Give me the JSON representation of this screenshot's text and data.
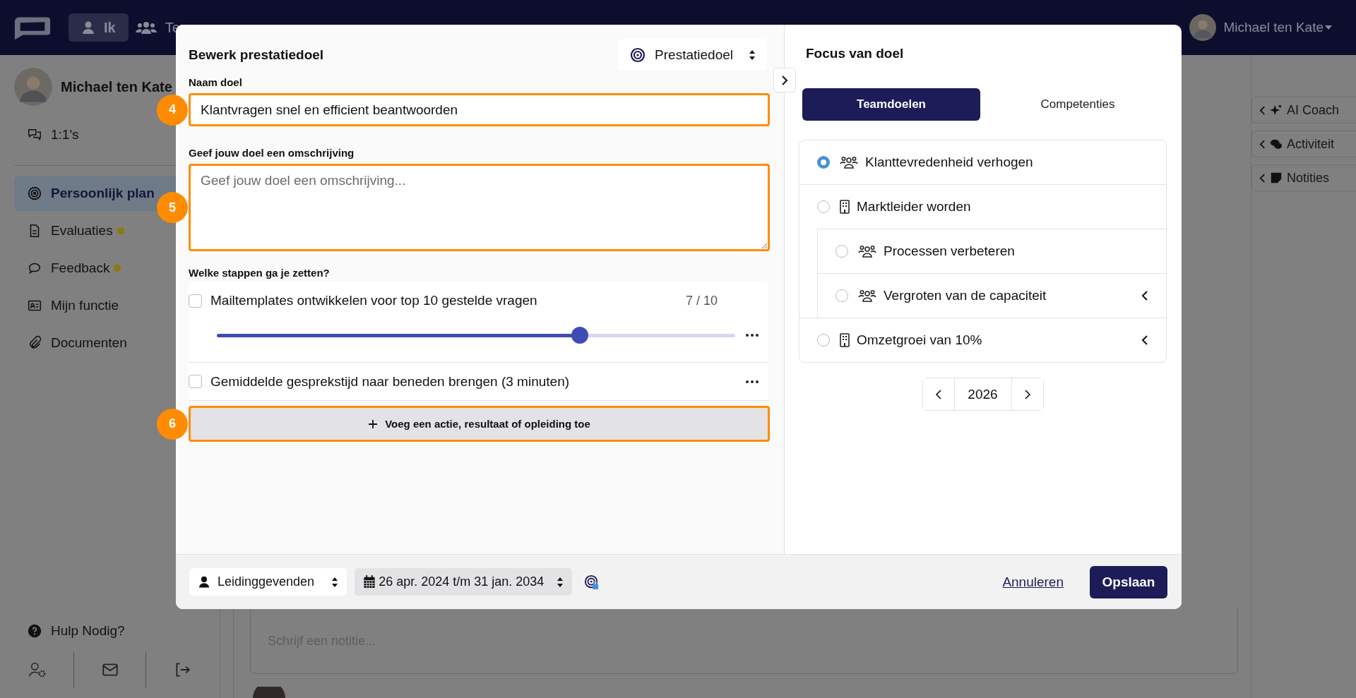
{
  "nav": {
    "tabs": [
      {
        "label": "Ik",
        "selected": true
      },
      {
        "label": "Te",
        "selected": false
      }
    ],
    "user": "Michael ten Kate"
  },
  "sidebar": {
    "profile_name": "Michael ten Kate",
    "top_item": "1:1's",
    "items": [
      {
        "label": "Persoonlijk plan",
        "selected": true,
        "dot": false
      },
      {
        "label": "Evaluaties",
        "selected": false,
        "dot": true
      },
      {
        "label": "Feedback",
        "selected": false,
        "dot": true
      },
      {
        "label": "Mijn functie",
        "selected": false,
        "dot": false
      },
      {
        "label": "Documenten",
        "selected": false,
        "dot": false
      }
    ],
    "help": "Hulp Nodig?"
  },
  "side_panels": [
    "AI Coach",
    "Activiteit",
    "Notities"
  ],
  "note": {
    "placeholder": "Schrijf een notitie..."
  },
  "modal": {
    "title": "Bewerk prestatiedoel",
    "type_select": "Prestatiedoel",
    "name_label": "Naam doel",
    "name_value": "Klantvragen snel en efficient beantwoorden",
    "name_marker": "4",
    "desc_label": "Geef jouw doel een omschrijving",
    "desc_placeholder": "Geef jouw doel een omschrijving...",
    "desc_marker": "5",
    "steps_label": "Welke stappen ga je zetten?",
    "steps": [
      {
        "kind": "slider",
        "label": "Mailtemplates ontwikkelen voor top 10 gestelde vragen",
        "checked": false,
        "reading": "7 / 10",
        "level": 0.7
      },
      {
        "kind": "plain",
        "label": "Gemiddelde gesprekstijd naar beneden brengen (3 minuten)",
        "checked": false
      }
    ],
    "add_button": "Voeg een actie, resultaat of opleiding toe",
    "add_marker": "6",
    "audience": "Leidinggevenden",
    "period": "26 apr. 2024 t/m 31 jan. 2034",
    "cancel": "Annuleren",
    "save": "Opslaan"
  },
  "focus": {
    "title": "Focus van doel",
    "tabs": [
      {
        "label": "Teamdoelen",
        "selected": true
      },
      {
        "label": "Competenties",
        "selected": false
      }
    ],
    "goals": [
      {
        "kind": "team",
        "label": "Klanttevredenheid verhogen",
        "selected": true
      },
      {
        "kind": "company",
        "label": "Marktleider worden",
        "selected": false,
        "expanded": true,
        "children": [
          {
            "kind": "team",
            "label": "Processen verbeteren",
            "selected": false
          },
          {
            "kind": "team",
            "label": "Vergroten van de capaciteit",
            "selected": false,
            "expanded": false
          }
        ]
      },
      {
        "kind": "company",
        "label": "Omzetgroei van 10%",
        "selected": false,
        "expanded": false
      }
    ],
    "year": "2026"
  }
}
